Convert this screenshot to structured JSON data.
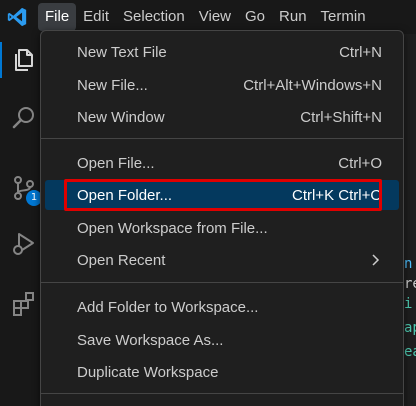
{
  "menubar": {
    "items": [
      {
        "label": "File"
      },
      {
        "label": "Edit"
      },
      {
        "label": "Selection"
      },
      {
        "label": "View"
      },
      {
        "label": "Go"
      },
      {
        "label": "Run"
      },
      {
        "label": "Termin"
      }
    ],
    "active_item": "File"
  },
  "activitybar": {
    "items": [
      {
        "icon": "explorer-icon"
      },
      {
        "icon": "search-icon"
      },
      {
        "icon": "source-control-icon",
        "badge": "1"
      },
      {
        "icon": "run-debug-icon"
      },
      {
        "icon": "extensions-icon"
      }
    ]
  },
  "file_menu": {
    "group1": [
      {
        "label": "New Text File",
        "shortcut": "Ctrl+N"
      },
      {
        "label": "New File...",
        "shortcut": "Ctrl+Alt+Windows+N"
      },
      {
        "label": "New Window",
        "shortcut": "Ctrl+Shift+N"
      }
    ],
    "group2": [
      {
        "label": "Open File...",
        "shortcut": "Ctrl+O"
      },
      {
        "label": "Open Folder...",
        "shortcut": "Ctrl+K Ctrl+O"
      },
      {
        "label": "Open Workspace from File...",
        "shortcut": ""
      },
      {
        "label": "Open Recent",
        "shortcut": ""
      }
    ],
    "group3": [
      {
        "label": "Add Folder to Workspace...",
        "shortcut": ""
      },
      {
        "label": "Save Workspace As...",
        "shortcut": ""
      },
      {
        "label": "Duplicate Workspace",
        "shortcut": ""
      }
    ],
    "highlighted_item": "Open Folder..."
  },
  "editor_peek": {
    "chars": [
      "n",
      "re",
      "i",
      "ap",
      "ea"
    ]
  },
  "colors": {
    "accent": "#0078d4",
    "selection_bg": "#04395e",
    "highlight_border": "#e00000",
    "menu_bg": "#1f1f1f"
  }
}
